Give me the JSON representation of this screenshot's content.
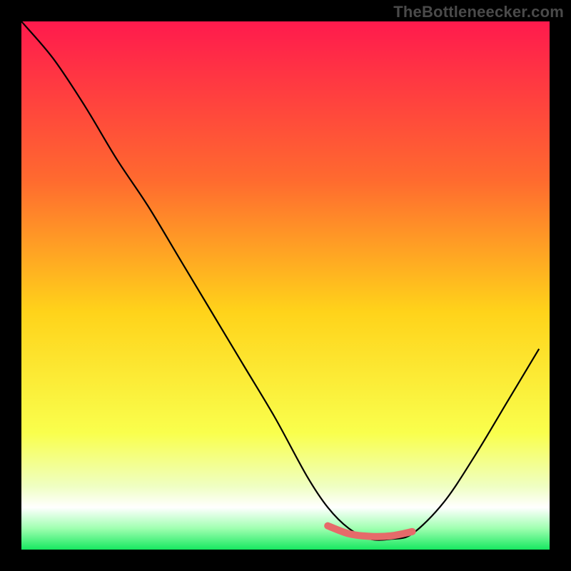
{
  "watermark": "TheBottleneecker.com",
  "colors": {
    "black": "#000000",
    "gradient_stops": [
      {
        "offset": 0.0,
        "color": "#ff1a4d"
      },
      {
        "offset": 0.3,
        "color": "#ff6a2f"
      },
      {
        "offset": 0.55,
        "color": "#ffd31a"
      },
      {
        "offset": 0.78,
        "color": "#f9ff4d"
      },
      {
        "offset": 0.88,
        "color": "#efffc2"
      },
      {
        "offset": 0.92,
        "color": "#ffffff"
      },
      {
        "offset": 0.96,
        "color": "#9fffb0"
      },
      {
        "offset": 1.0,
        "color": "#17e860"
      }
    ],
    "curve": "#000000",
    "highlight": "#e66a6a"
  },
  "chart_data": {
    "type": "line",
    "title": "",
    "xlabel": "",
    "ylabel": "",
    "xlim": [
      0,
      100
    ],
    "ylim": [
      0,
      100
    ],
    "grid": false,
    "legend": false,
    "series": [
      {
        "name": "main-curve",
        "x": [
          0,
          6,
          12,
          18,
          24,
          30,
          36,
          42,
          48,
          54,
          58,
          62,
          66,
          70,
          74,
          80,
          86,
          92,
          98
        ],
        "values": [
          100,
          93,
          84,
          74,
          65,
          55,
          45,
          35,
          25,
          14,
          8,
          4,
          2,
          2,
          3,
          9,
          18,
          28,
          38
        ]
      },
      {
        "name": "highlight-segment",
        "x": [
          58,
          62,
          66,
          70,
          74
        ],
        "values": [
          4.5,
          3.0,
          2.5,
          2.6,
          3.4
        ]
      }
    ],
    "annotations": []
  }
}
